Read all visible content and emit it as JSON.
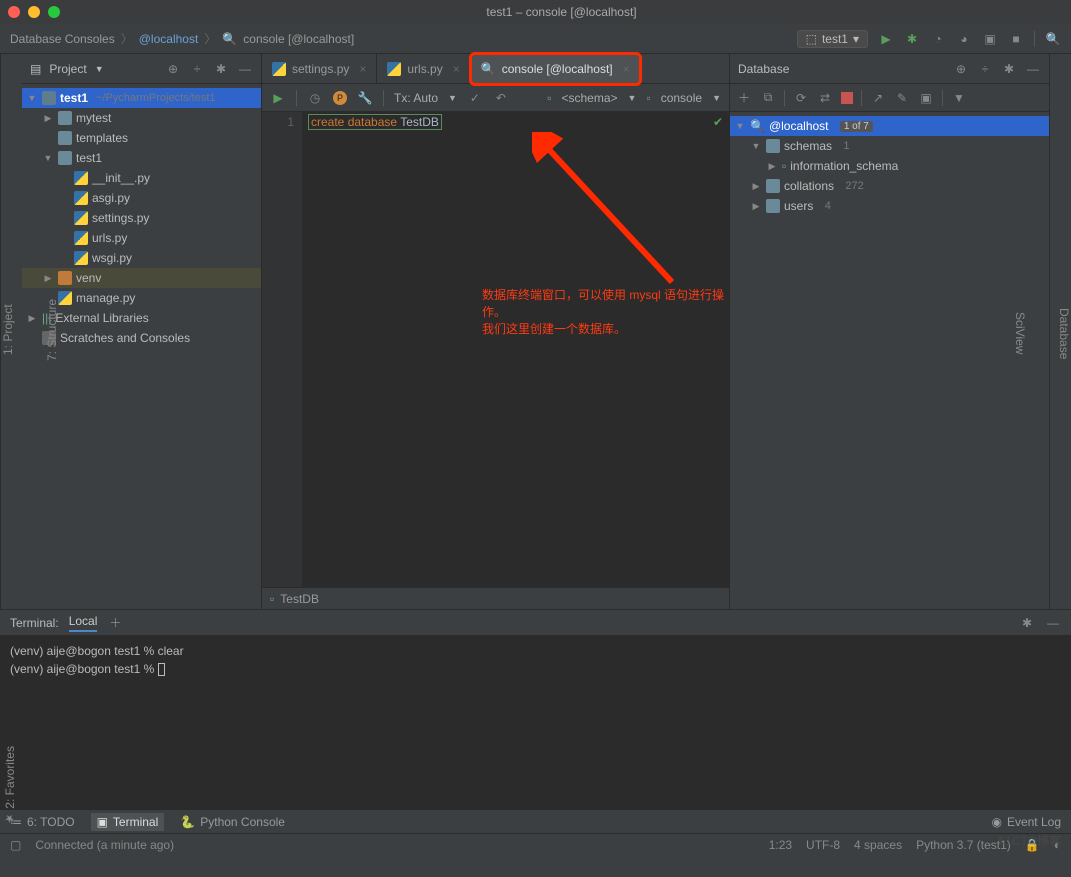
{
  "window": {
    "title": "test1 – console [@localhost]"
  },
  "breadcrumbs": [
    "Database Consoles",
    "@localhost",
    "console [@localhost]"
  ],
  "run_config": "test1",
  "project_panel": {
    "title": "Project"
  },
  "tree": {
    "root": {
      "name": "test1",
      "path": "~/PycharmProjects/test1"
    },
    "mytest": "mytest",
    "templates": "templates",
    "test1": "test1",
    "files": [
      "__init__.py",
      "asgi.py",
      "settings.py",
      "urls.py",
      "wsgi.py"
    ],
    "venv": "venv",
    "manage": "manage.py",
    "ext": "External Libraries",
    "scratch": "Scratches and Consoles"
  },
  "tabs": [
    {
      "label": "settings.py"
    },
    {
      "label": "urls.py"
    },
    {
      "label": "console [@localhost]"
    }
  ],
  "toolbar": {
    "tx": "Tx: Auto",
    "schema": "<schema>",
    "console": "console"
  },
  "code": {
    "kw1": "create",
    "kw2": "database",
    "name": "TestDB",
    "line": "1"
  },
  "annotation": {
    "l1": "数据库终端窗口，可以使用 mysql 语句进行操作。",
    "l2": "我们这里创建一个数据库。"
  },
  "editor_status": "TestDB",
  "db_panel": {
    "title": "Database"
  },
  "db": {
    "host": "@localhost",
    "badge": "1 of 7",
    "schemas": "schemas",
    "schemas_n": "1",
    "info": "information_schema",
    "coll": "collations",
    "coll_n": "272",
    "users": "users",
    "users_n": "4"
  },
  "terminal": {
    "title": "Terminal:",
    "tab": "Local",
    "l1": "(venv) aije@bogon test1 % clear",
    "l2": "(venv) aije@bogon test1 % "
  },
  "bottom": {
    "todo": "6: TODO",
    "term": "Terminal",
    "pycon": "Python Console",
    "eventlog": "Event Log"
  },
  "status": {
    "conn": "Connected (a minute ago)",
    "pos": "1:23",
    "enc": "UTF-8",
    "indent": "4 spaces",
    "sdk": "Python 3.7 (test1)"
  },
  "stripe": {
    "project": "1: Project",
    "structure": "7: Structure",
    "fav": "2: Favorites",
    "database": "Database",
    "sciview": "SciView"
  },
  "watermark": "51CTO博客"
}
